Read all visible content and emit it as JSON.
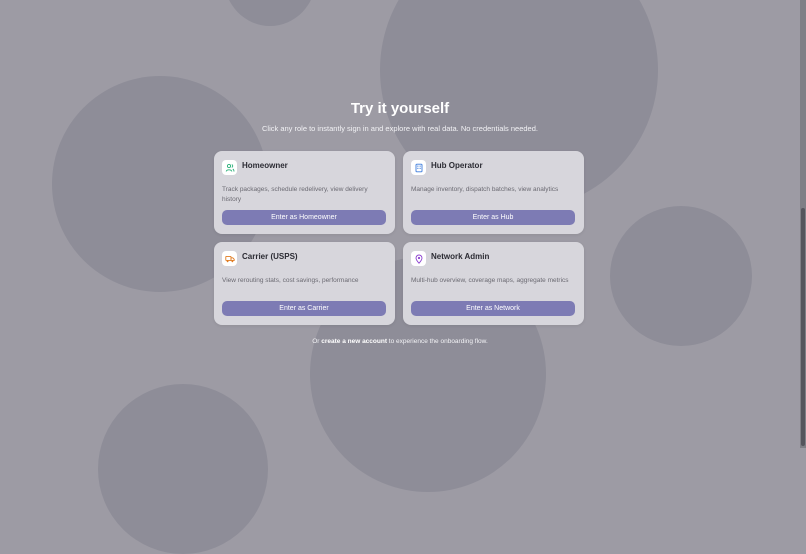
{
  "hero": {
    "title": "Try it yourself",
    "subtitle": "Click any role to instantly sign in and explore with real data. No credentials needed."
  },
  "roles": [
    {
      "title": "Homeowner",
      "description": "Track packages, schedule redelivery, view delivery history",
      "button": "Enter as Homeowner",
      "icon": "users-icon",
      "icon_color": "#2bb17a"
    },
    {
      "title": "Hub Operator",
      "description": "Manage inventory, dispatch batches, view analytics",
      "button": "Enter as Hub",
      "icon": "building-icon",
      "icon_color": "#3b7bdc"
    },
    {
      "title": "Carrier (USPS)",
      "description": "View rerouting stats, cost savings, performance",
      "button": "Enter as Carrier",
      "icon": "truck-icon",
      "icon_color": "#e07a1f"
    },
    {
      "title": "Network Admin",
      "description": "Multi-hub overview, coverage maps, aggregate metrics",
      "button": "Enter as Network",
      "icon": "map-pin-icon",
      "icon_color": "#8b3fd0"
    }
  ],
  "footer": {
    "prefix": "Or",
    "link": "create a new account",
    "suffix": "to experience the onboarding flow."
  },
  "colors": {
    "background": "#9d9ba4",
    "card": "#d7d6dc",
    "button": "#7d7bb4"
  }
}
